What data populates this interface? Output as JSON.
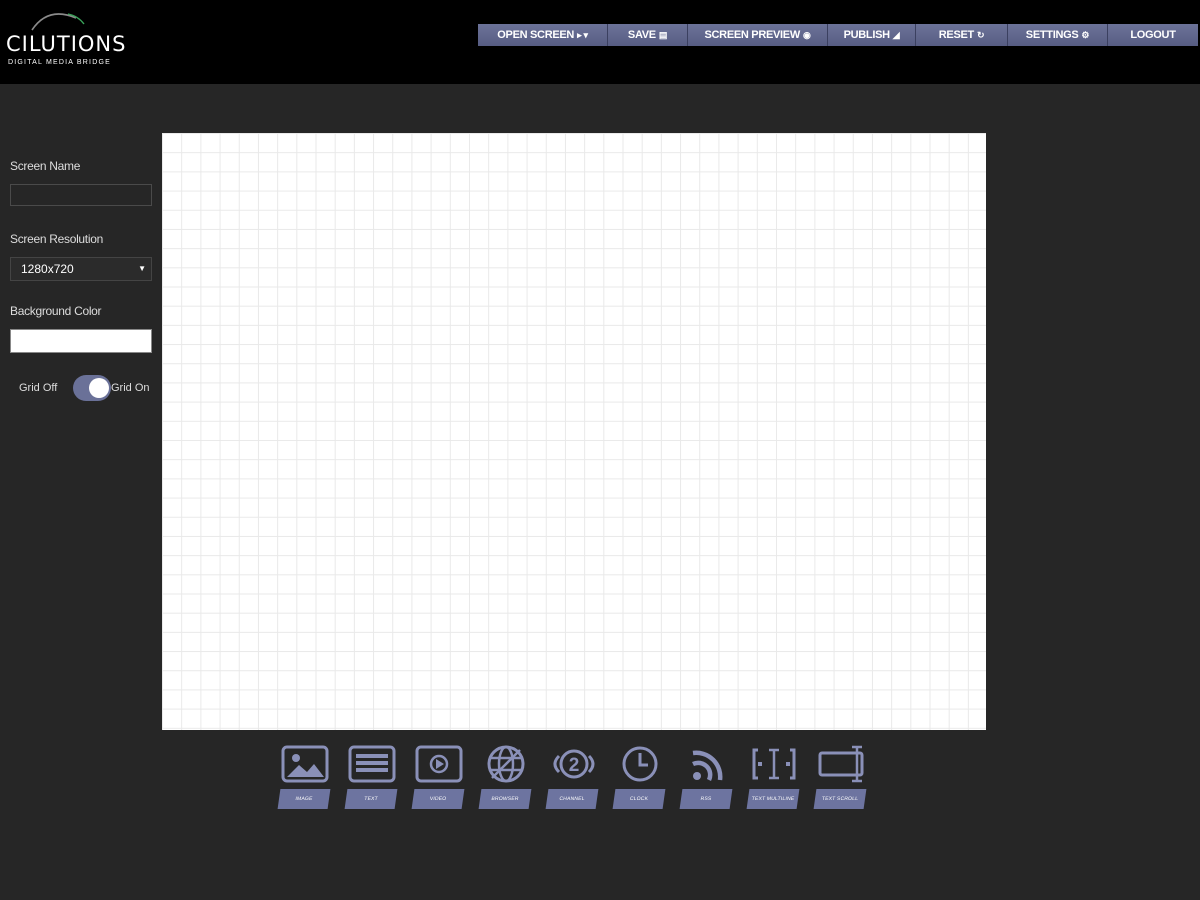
{
  "brand": {
    "name": "CILUTIONS",
    "tagline": "DIGITAL MEDIA BRIDGE"
  },
  "nav": [
    {
      "label": "OPEN SCREEN",
      "icon": "open-file-icon",
      "glyph": "▸ ▾"
    },
    {
      "label": "SAVE",
      "icon": "save-icon",
      "glyph": "▤"
    },
    {
      "label": "SCREEN PREVIEW",
      "icon": "preview-icon",
      "glyph": "◉"
    },
    {
      "label": "PUBLISH",
      "icon": "send-icon",
      "glyph": "◢"
    },
    {
      "label": "RESET",
      "icon": "refresh-icon",
      "glyph": "↻"
    },
    {
      "label": "SETTINGS",
      "icon": "gear-icon",
      "glyph": "⚙"
    },
    {
      "label": "LOGOUT",
      "icon": "",
      "glyph": ""
    }
  ],
  "sidebar": {
    "screen_name_label": "Screen Name",
    "screen_name_value": "",
    "resolution_label": "Screen Resolution",
    "resolution_value": "1280x720",
    "background_label": "Background Color",
    "background_value": "#ffffff",
    "grid_off_label": "Grid Off",
    "grid_on_label": "Grid On",
    "grid_enabled": true
  },
  "widgets": [
    {
      "label": "IMAGE",
      "icon": "image-icon"
    },
    {
      "label": "TEXT",
      "icon": "text-icon"
    },
    {
      "label": "VIDEO",
      "icon": "video-icon"
    },
    {
      "label": "BROWSER",
      "icon": "globe-icon"
    },
    {
      "label": "CHANNEL",
      "icon": "channel-icon"
    },
    {
      "label": "CLOCK",
      "icon": "clock-icon"
    },
    {
      "label": "RSS",
      "icon": "rss-icon"
    },
    {
      "label": "TEXT MULTILINE",
      "icon": "text-multiline-icon"
    },
    {
      "label": "TEXT SCROLL",
      "icon": "text-scroll-icon"
    }
  ],
  "colors": {
    "background": "#262626",
    "header": "#000000",
    "accent": "#6d74a0",
    "canvas": "#ffffff"
  }
}
